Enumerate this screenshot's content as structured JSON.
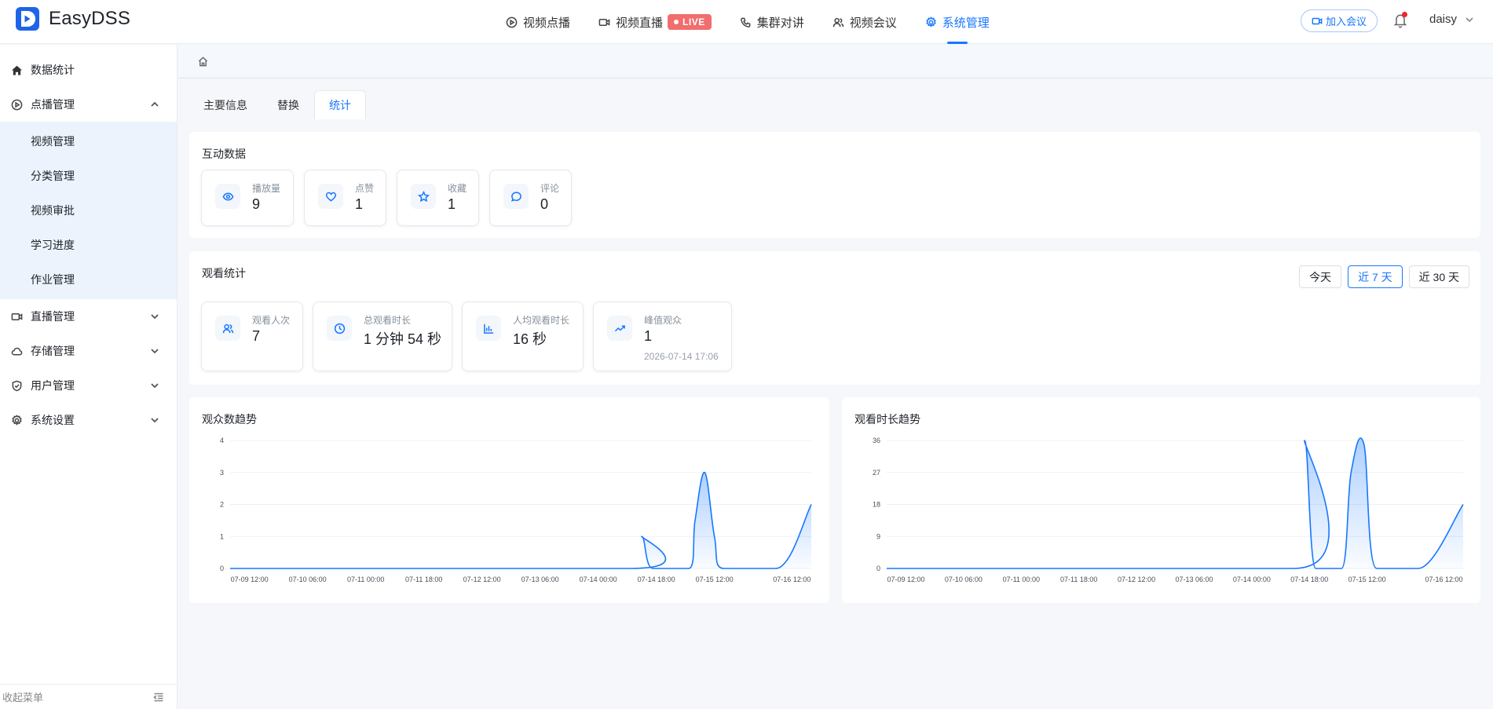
{
  "brand": {
    "name": "EasyDSS"
  },
  "topnav": [
    {
      "label": "视频点播",
      "icon": "play-circle-icon",
      "active": false
    },
    {
      "label": "视频直播",
      "icon": "video-camera-icon",
      "active": false,
      "badge": "LIVE"
    },
    {
      "label": "集群对讲",
      "icon": "phone-icon",
      "active": false
    },
    {
      "label": "视频会议",
      "icon": "users-icon",
      "active": false
    },
    {
      "label": "系统管理",
      "icon": "gear-icon",
      "active": true
    }
  ],
  "header": {
    "join_label": "加入会议",
    "username": "daisy"
  },
  "sidebar": {
    "items": [
      {
        "label": "数据统计"
      },
      {
        "label": "点播管理"
      },
      {
        "label": "直播管理"
      },
      {
        "label": "存储管理"
      },
      {
        "label": "用户管理"
      },
      {
        "label": "系统设置"
      }
    ],
    "sub_items": [
      {
        "label": "视频管理"
      },
      {
        "label": "分类管理"
      },
      {
        "label": "视频审批"
      },
      {
        "label": "学习进度"
      },
      {
        "label": "作业管理"
      }
    ],
    "collapse_label": "收起菜单"
  },
  "tabs": [
    {
      "label": "主要信息"
    },
    {
      "label": "替换"
    },
    {
      "label": "统计"
    }
  ],
  "interaction": {
    "title": "互动数据",
    "stats": [
      {
        "label": "播放量",
        "value": "9",
        "icon": "eye-icon"
      },
      {
        "label": "点赞",
        "value": "1",
        "icon": "heart-icon"
      },
      {
        "label": "收藏",
        "value": "1",
        "icon": "star-icon"
      },
      {
        "label": "评论",
        "value": "0",
        "icon": "comment-icon"
      }
    ]
  },
  "viewing": {
    "title": "观看统计",
    "ranges": [
      {
        "label": "今天"
      },
      {
        "label": "近 7 天",
        "active": true
      },
      {
        "label": "近 30 天"
      }
    ],
    "stats": [
      {
        "label": "观看人次",
        "value": "7",
        "icon": "users-icon"
      },
      {
        "label": "总观看时长",
        "value": "1 分钟 54 秒",
        "icon": "clock-icon"
      },
      {
        "label": "人均观看时长",
        "value": "16 秒",
        "icon": "bar-chart-icon"
      },
      {
        "label": "峰值观众",
        "value": "1",
        "sub": "2026-07-14 17:06",
        "icon": "trend-icon"
      }
    ]
  },
  "accent_color": "#1677ff",
  "chart_data": [
    {
      "type": "area",
      "title": "观众数趋势",
      "x_ticks": [
        "07-09 12:00",
        "07-10 06:00",
        "07-11 00:00",
        "07-11 18:00",
        "07-12 12:00",
        "07-13 06:00",
        "07-14 00:00",
        "07-14 18:00",
        "07-15 12:00",
        "07-16 12:00"
      ],
      "x_tick_hours": [
        12,
        30,
        48,
        66,
        84,
        102,
        120,
        138,
        156,
        180
      ],
      "x_range_hours": [
        6,
        186
      ],
      "y_ticks": [
        0,
        1,
        2,
        3,
        4
      ],
      "ylim": [
        0,
        4
      ],
      "points": [
        [
          6,
          0
        ],
        [
          130,
          0
        ],
        [
          133.5,
          1
        ],
        [
          137,
          0
        ],
        [
          148,
          0
        ],
        [
          150,
          1.5
        ],
        [
          153,
          3
        ],
        [
          156,
          1
        ],
        [
          159,
          0
        ],
        [
          175,
          0
        ],
        [
          186,
          2
        ]
      ],
      "grid": true
    },
    {
      "type": "area",
      "title": "观看时长趋势",
      "x_ticks": [
        "07-09 12:00",
        "07-10 06:00",
        "07-11 00:00",
        "07-11 18:00",
        "07-12 12:00",
        "07-13 06:00",
        "07-14 00:00",
        "07-14 18:00",
        "07-15 12:00",
        "07-16 12:00"
      ],
      "x_tick_hours": [
        12,
        30,
        48,
        66,
        84,
        102,
        120,
        138,
        156,
        180
      ],
      "x_range_hours": [
        6,
        186
      ],
      "y_ticks": [
        0,
        9,
        18,
        27,
        36
      ],
      "ylim": [
        0,
        36
      ],
      "points": [
        [
          6,
          0
        ],
        [
          133,
          0
        ],
        [
          136.5,
          36
        ],
        [
          140,
          0
        ],
        [
          148,
          0
        ],
        [
          151,
          27
        ],
        [
          155,
          35
        ],
        [
          159,
          0
        ],
        [
          172,
          0
        ],
        [
          186,
          18
        ]
      ],
      "grid": true
    }
  ]
}
